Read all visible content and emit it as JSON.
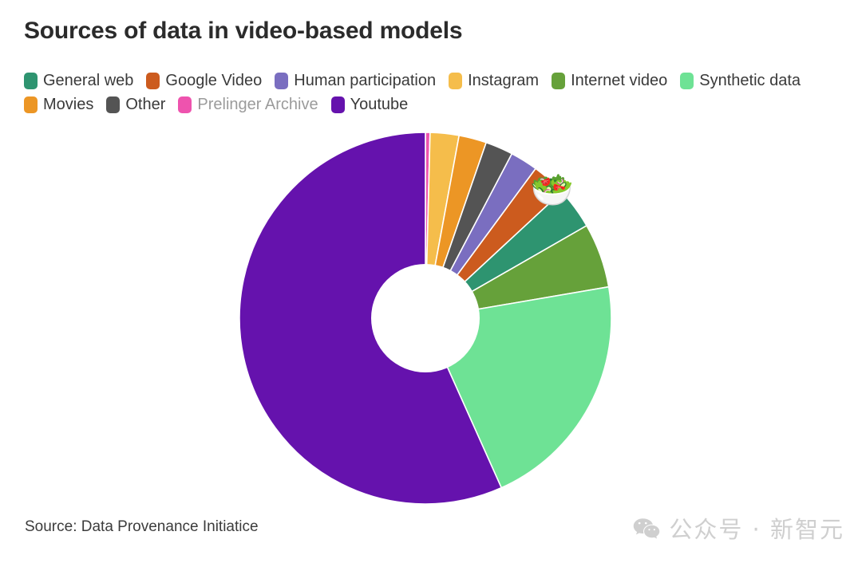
{
  "header": {
    "title": "Sources of data in video-based models"
  },
  "footer": {
    "source": "Source: Data Provenance Initiatice",
    "watermark_text": "公众号 · 新智元",
    "watermark_icon": "wechat-icon"
  },
  "overlay": {
    "emoji": "🥗",
    "emoji_name": "salad-bowl-emoji"
  },
  "legend": {
    "items": [
      {
        "label": "General web",
        "color": "#2e9470",
        "muted": false
      },
      {
        "label": "Google Video",
        "color": "#cc5b1e",
        "muted": false
      },
      {
        "label": "Human participation",
        "color": "#7a6ec0",
        "muted": false
      },
      {
        "label": "Instagram",
        "color": "#f5bd4b",
        "muted": false
      },
      {
        "label": "Internet video",
        "color": "#66a13a",
        "muted": false
      },
      {
        "label": "Synthetic data",
        "color": "#6ee295",
        "muted": false
      },
      {
        "label": "Movies",
        "color": "#ec9625",
        "muted": false
      },
      {
        "label": "Other",
        "color": "#545454",
        "muted": false
      },
      {
        "label": "Prelinger Archive",
        "color": "#ee53ae",
        "muted": true
      },
      {
        "label": "Youtube",
        "color": "#6512ad",
        "muted": false
      }
    ]
  },
  "chart_data": {
    "type": "pie",
    "variant": "donut",
    "title": "Sources of data in video-based models",
    "source": "Data Provenance Initiatice",
    "legend_position": "top",
    "start_angle_deg": 0,
    "direction": "clockwise",
    "inner_radius_ratio": 0.29,
    "unit": "percent",
    "categories": [
      "Prelinger Archive",
      "Instagram",
      "Movies",
      "Other",
      "Human participation",
      "Google Video",
      "General web",
      "Internet video",
      "Synthetic data",
      "Youtube"
    ],
    "values": [
      0.4,
      2.5,
      2.4,
      2.4,
      2.4,
      3.0,
      3.6,
      5.6,
      21.0,
      56.7
    ],
    "colors": [
      "#ee53ae",
      "#f5bd4b",
      "#ec9625",
      "#545454",
      "#7a6ec0",
      "#cc5b1e",
      "#2e9470",
      "#66a13a",
      "#6ee295",
      "#6512ad"
    ]
  }
}
